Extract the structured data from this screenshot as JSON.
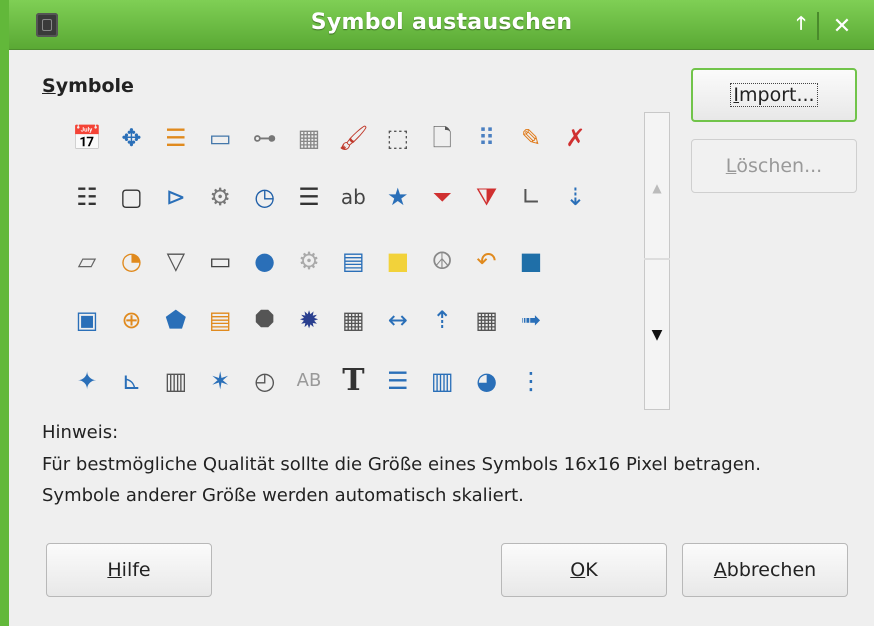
{
  "window": {
    "title": "Symbol austauschen"
  },
  "titlebar": {
    "app_icon": "app-icon",
    "up_glyph": "🡑",
    "close_glyph": "✕"
  },
  "symbols": {
    "label_prefix": "S",
    "label_rest": "ymbole",
    "grid": [
      [
        "calendar-24-icon",
        "move-icon",
        "bullet-list-icon",
        "abc-field-icon",
        "tree-view-icon",
        "table-grid-icon",
        "paintbrush-icon",
        "select-cursor-icon",
        "document-cursor-icon",
        "dotted-grid-icon",
        "pencil-icon",
        "delete-link-icon"
      ],
      [
        "numbered-list-icon",
        "frame-icon",
        "polygon-select-icon",
        "gear-icon",
        "clock-icon",
        "list-icon",
        "spellcheck-icon",
        "star-icon",
        "clear-filter-icon",
        "remove-filter-icon",
        "l-shape-icon",
        "sort-down-icon"
      ],
      [
        "parallelogram-icon",
        "shapes-icon",
        "filter-icon",
        "ok-button-icon",
        "speech-bubble-icon",
        "gear-outline-icon",
        "edit-form-icon",
        "sticky-note-icon",
        "peace-icon",
        "undo-arrow-icon",
        "cube-icon"
      ],
      [
        "image-zoom-icon",
        "align-center-icon",
        "label-tag-icon",
        "book-icon",
        "octagon-icon",
        "burst-icon",
        "form-controls-icon",
        "double-arrow-icon",
        "sort-up-icon",
        "date-field-icon",
        "arrow-right-icon"
      ],
      [
        "four-point-star-icon",
        "l-corner-icon",
        "text-columns-icon",
        "six-point-star-icon",
        "clock-outline-icon",
        "ab-text-icon",
        "bold-t-icon",
        "indent-list-icon",
        "table-frame-icon",
        "pie-moon-icon",
        "dotted-list-icon"
      ]
    ]
  },
  "buttons": {
    "import": {
      "prefix": "I",
      "rest": "mport..."
    },
    "loeschen": {
      "prefix": "L",
      "rest": "öschen..."
    },
    "hilfe": {
      "prefix": "H",
      "rest": "ilfe"
    },
    "ok": {
      "prefix": "O",
      "rest": "K"
    },
    "abbrechen": {
      "prefix": "A",
      "rest": "bbrechen"
    }
  },
  "hint": {
    "title": "Hinweis:",
    "line1": "Für bestmögliche Qualität sollte die Größe eines Symbols 16x16 Pixel betragen.",
    "line2": "Symbole anderer Größe werden automatisch skaliert."
  },
  "colors": {
    "accent": "#62b83a",
    "title_text": "#ffffff"
  }
}
